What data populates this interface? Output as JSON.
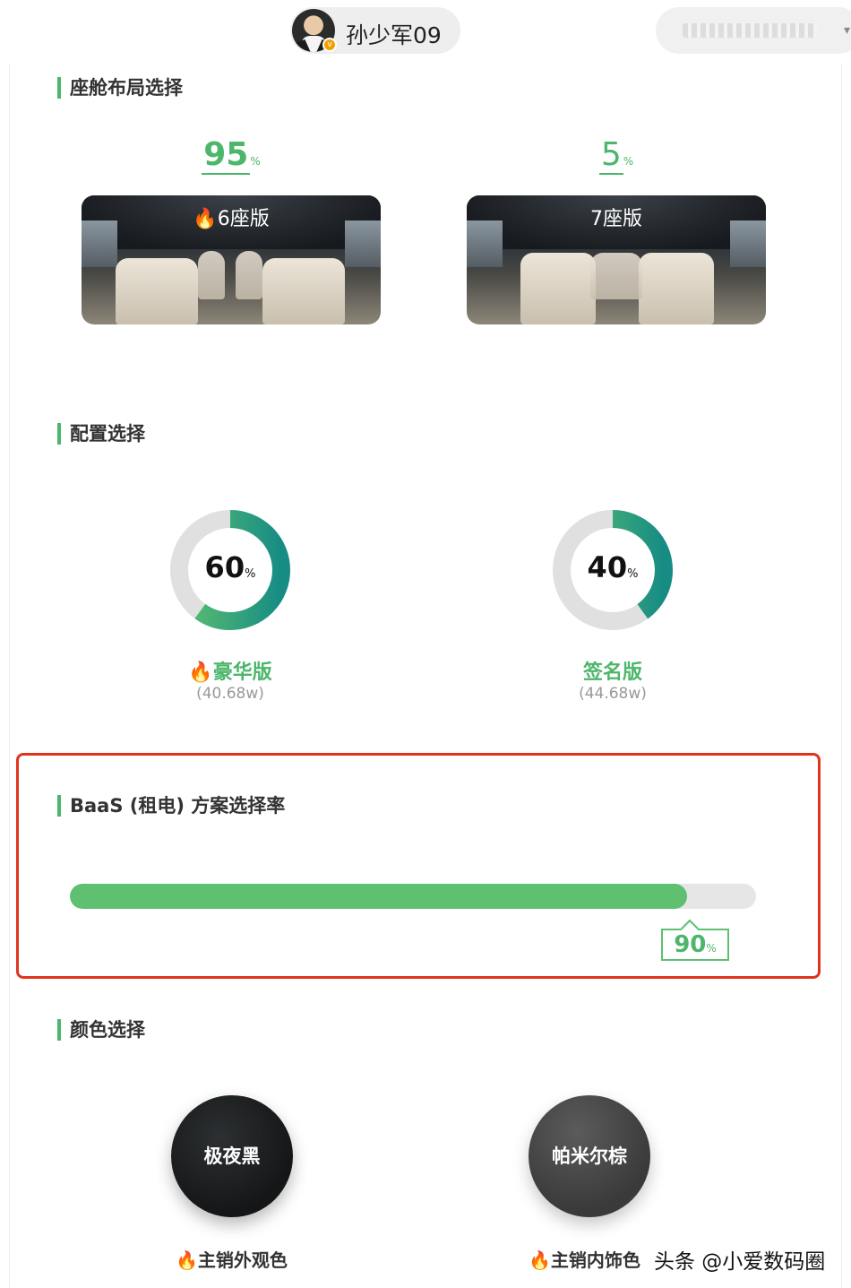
{
  "header": {
    "user_name": "孙少军09",
    "verified_badge": "v",
    "avatar_icon": "avatar-photo",
    "right_pill_caret": "▾"
  },
  "layout_section": {
    "title": "座舱布局选择",
    "options": [
      {
        "label": "6座版",
        "percent": "95",
        "unit": "%",
        "hot": true
      },
      {
        "label": "7座版",
        "percent": "5",
        "unit": "%",
        "hot": false
      }
    ]
  },
  "config_section": {
    "title": "配置选择",
    "options": [
      {
        "name": "豪华版",
        "price": "(40.68w)",
        "percent": "60",
        "unit": "%",
        "ratio": 0.6,
        "hot": true
      },
      {
        "name": "签名版",
        "price": "(44.68w)",
        "percent": "40",
        "unit": "%",
        "ratio": 0.4,
        "hot": false
      }
    ]
  },
  "baas_section": {
    "title": "BaaS (租电) 方案选择率",
    "percent": "90",
    "unit": "%",
    "ratio": 0.9
  },
  "color_section": {
    "title": "颜色选择",
    "options": [
      {
        "name": "极夜黑",
        "note": "主销外观色",
        "hot": true
      },
      {
        "name": "帕米尔棕",
        "note": "主销内饰色",
        "hot": true
      }
    ]
  },
  "watermark": "头条 @小爱数码圈",
  "colors": {
    "accent_green": "#4cb66a",
    "flame_red": "#e94a2c",
    "highlight_red": "#e0341f",
    "track_gray": "#e6e6e6"
  },
  "icons": {
    "flame": "flame-icon",
    "flame_glyph": "🔥"
  }
}
